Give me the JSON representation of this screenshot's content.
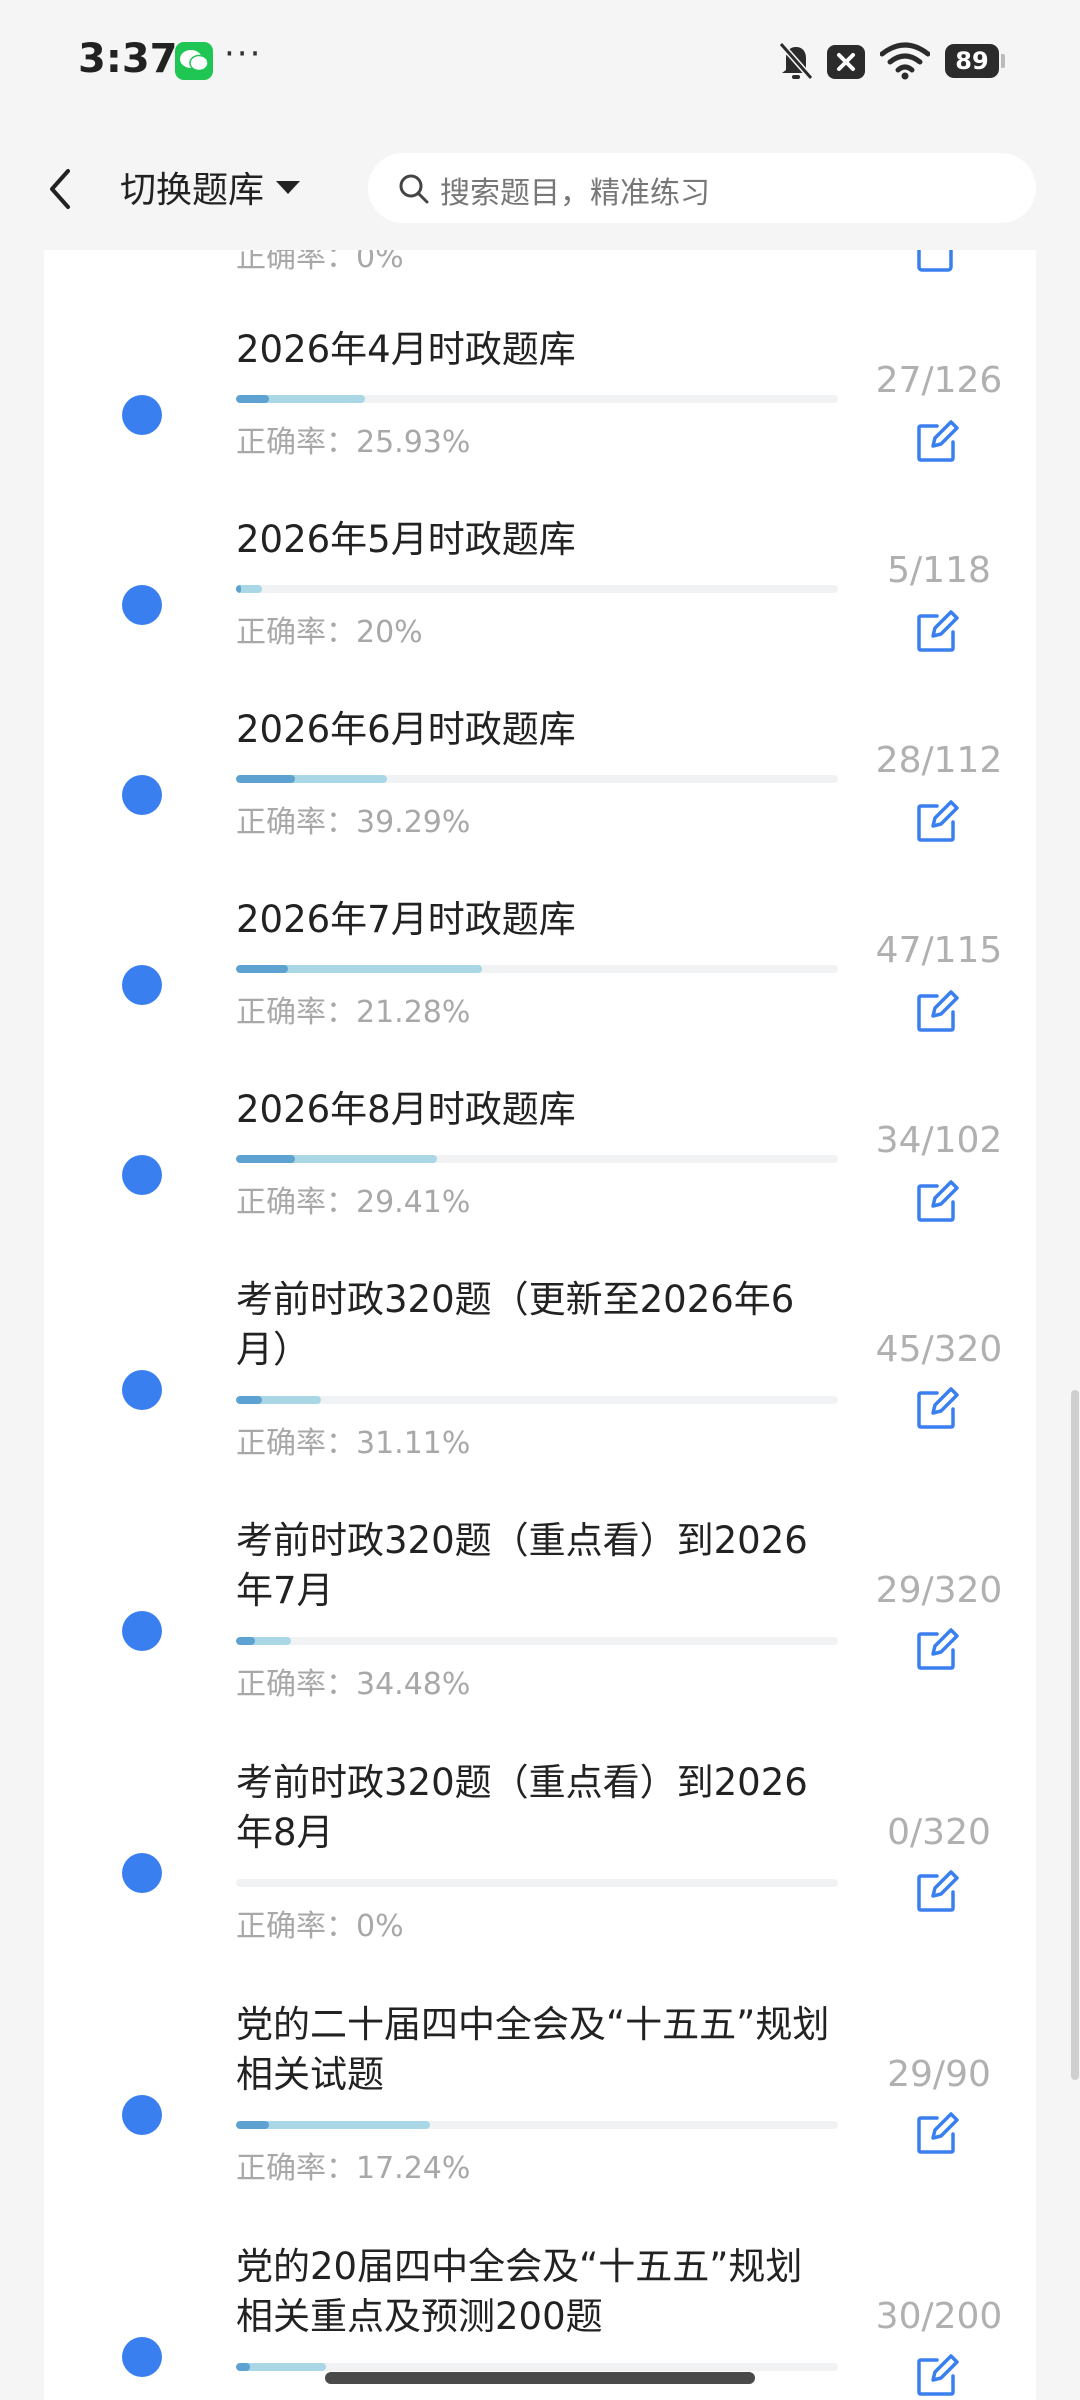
{
  "status_bar": {
    "time": "3:37",
    "battery": "89",
    "more": "···"
  },
  "header": {
    "switch_label": "切换题库",
    "search_placeholder": "搜索题目，精准练习"
  },
  "partial_top": {
    "rate": "正确率：0%"
  },
  "items": [
    {
      "title": "2026年4月时政题库",
      "rate": "正确率：25.93%",
      "count": "27/126",
      "total": 126,
      "done": 27,
      "correct_frac": 0.2593
    },
    {
      "title": "2026年5月时政题库",
      "rate": "正确率：20%",
      "count": "5/118",
      "total": 118,
      "done": 5,
      "correct_frac": 0.2
    },
    {
      "title": "2026年6月时政题库",
      "rate": "正确率：39.29%",
      "count": "28/112",
      "total": 112,
      "done": 28,
      "correct_frac": 0.3929
    },
    {
      "title": "2026年7月时政题库",
      "rate": "正确率：21.28%",
      "count": "47/115",
      "total": 115,
      "done": 47,
      "correct_frac": 0.2128
    },
    {
      "title": "2026年8月时政题库",
      "rate": "正确率：29.41%",
      "count": "34/102",
      "total": 102,
      "done": 34,
      "correct_frac": 0.2941
    },
    {
      "title": "考前时政320题（更新至2026年6月）",
      "rate": "正确率：31.11%",
      "count": "45/320",
      "total": 320,
      "done": 45,
      "correct_frac": 0.3111
    },
    {
      "title": "考前时政320题（重点看）到2026年7月",
      "rate": "正确率：34.48%",
      "count": "29/320",
      "total": 320,
      "done": 29,
      "correct_frac": 0.3448
    },
    {
      "title": "考前时政320题（重点看）到2026年8月",
      "rate": "正确率：0%",
      "count": "0/320",
      "total": 320,
      "done": 0,
      "correct_frac": 0
    },
    {
      "title": "党的二十届四中全会及“十五五”规划相关试题",
      "rate": "正确率：17.24%",
      "count": "29/90",
      "total": 90,
      "done": 29,
      "correct_frac": 0.1724
    },
    {
      "title": "党的20届四中全会及“十五五”规划相关重点及预测200题",
      "rate": "",
      "count": "30/200",
      "total": 200,
      "done": 30,
      "correct_frac": 0.15
    }
  ]
}
